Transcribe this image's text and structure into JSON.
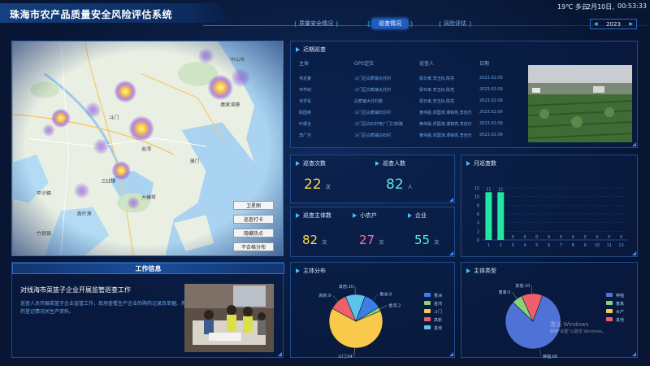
{
  "header": {
    "title": "珠海市农产品质量安全风险评估系统",
    "weather": "19℃ 多云",
    "date": "2月10日,",
    "time": "00:53:33",
    "year": "2023",
    "year_prev": "◀",
    "year_next": "▶",
    "tabs": [
      {
        "label": "质量安全情况",
        "active": false
      },
      {
        "label": "巡查情况",
        "active": true
      },
      {
        "label": "风险评估",
        "active": false
      }
    ]
  },
  "map": {
    "buttons": [
      "卫星图",
      "巡查打卡",
      "隐藏热点",
      "不合格分布"
    ],
    "labels": [
      {
        "text": "中山市",
        "id": "m1"
      },
      {
        "text": "唐家湾镇",
        "id": "m2"
      },
      {
        "text": "斗门",
        "id": "m3"
      },
      {
        "text": "大横琴",
        "id": "m4"
      },
      {
        "text": "金湾",
        "id": "m5"
      },
      {
        "text": "三灶镇",
        "id": "m6"
      },
      {
        "text": "平沙镇",
        "id": "m7"
      },
      {
        "text": "高栏港",
        "id": "m8"
      },
      {
        "text": "竹银镇",
        "id": "m9"
      },
      {
        "text": "澳门",
        "id": "m10"
      }
    ]
  },
  "work": {
    "heading": "工作信息",
    "title": "对线海市菜篮子企业开展监管巡查工作",
    "desc": "巡查人员开展菜篮子企业监管工作，现场查看生产企业的购药记录及单据、用药登记情况关生产资料。"
  },
  "table": {
    "title": "近期巡查",
    "headers": [
      "主体",
      "GPS定位",
      "巡查人",
      "日期"
    ],
    "rows": [
      [
        "韦定宴",
        "斗门区白蕉镇大托村",
        "梁日孝,李玉标,陈亮",
        "2023.02.09"
      ],
      [
        "韦学树",
        "斗门区白蕉镇大托村",
        "梁日孝,李玉标,陈亮",
        "2023.02.09"
      ],
      [
        "韦学军",
        "白蕉镇大托村惠",
        "梁日孝,李玉标,陈亮",
        "2023.02.09"
      ],
      [
        "陈国英",
        "斗门区白蕉镇石衍村",
        "黄伟晨,邓国涛,谭锦亮,李佳乐",
        "2023.02.09"
      ],
      [
        "叶振全",
        "斗门区白石村电厂门口新路",
        "黄伟晨,邓国涛,谭锦亮,李佳乐",
        "2023.02.09"
      ],
      [
        "李广杰",
        "斗门区白蕉镇白石村",
        "黄伟晨,邓国涛,谭锦亮,李佳乐",
        "2023.02.09"
      ]
    ]
  },
  "stats": {
    "inspections": {
      "label": "巡查次数",
      "value": "22",
      "unit": "次"
    },
    "inspectors": {
      "label": "巡查人数",
      "value": "82",
      "unit": "人"
    },
    "subjects": {
      "label": "巡查主体数",
      "value": "82",
      "unit": "次"
    },
    "small": {
      "label": "小农户",
      "value": "27",
      "unit": "次"
    },
    "enterprise": {
      "label": "企业",
      "value": "55",
      "unit": "次"
    }
  },
  "colors": {
    "accent": "#3ec3ff",
    "green_bar": "#21e6a0",
    "yellow_val": "#ffd84a",
    "teal_val": "#5ee6e0",
    "pink_val": "#ff6f9a"
  },
  "chart_data": [
    {
      "type": "bar",
      "title": "月巡查数",
      "categories": [
        "1",
        "2",
        "3",
        "4",
        "5",
        "6",
        "7",
        "8",
        "9",
        "10",
        "11",
        "12"
      ],
      "values": [
        11,
        11,
        0,
        0,
        0,
        0,
        0,
        0,
        0,
        0,
        0,
        0
      ],
      "yticks": [
        0,
        2,
        4,
        6,
        8,
        10,
        12
      ],
      "ylim": [
        0,
        12
      ],
      "color": "#21e6a0"
    },
    {
      "type": "pie",
      "title": "主体分布",
      "slices": [
        {
          "label": "香洲",
          "value": 9,
          "color": "#3d7ee6",
          "text": "香洲:9"
        },
        {
          "label": "金湾",
          "value": 2,
          "color": "#8bd17c",
          "text": "金湾:2"
        },
        {
          "label": "斗门",
          "value": 54,
          "color": "#f8c94b",
          "text": "斗门:54"
        },
        {
          "label": "高新",
          "value": 9,
          "color": "#f0606a",
          "text": "高新:9"
        },
        {
          "label": "其他",
          "value": 10,
          "color": "#5bc4e8",
          "text": "其他:10"
        }
      ],
      "legend": [
        "香洲",
        "金湾",
        "斗门",
        "高新",
        "其他"
      ]
    },
    {
      "type": "pie",
      "title": "主体类型",
      "slices": [
        {
          "label": "种植",
          "value": 66,
          "color": "#4f72d6",
          "text": "种植:66"
        },
        {
          "label": "畜禽",
          "value": 5,
          "color": "#8bd17c",
          "text": "畜禽:5"
        },
        {
          "label": "水产",
          "value": 0,
          "color": "#f8c94b",
          "text": ""
        },
        {
          "label": "其他",
          "value": 10,
          "color": "#f0606a",
          "text": "其他:10"
        }
      ],
      "legend": [
        "种植",
        "畜禽",
        "水产",
        "其他"
      ]
    }
  ],
  "watermark": {
    "line1": "激活 Windows",
    "line2": "转到\"设置\"以激活 Windows。"
  }
}
